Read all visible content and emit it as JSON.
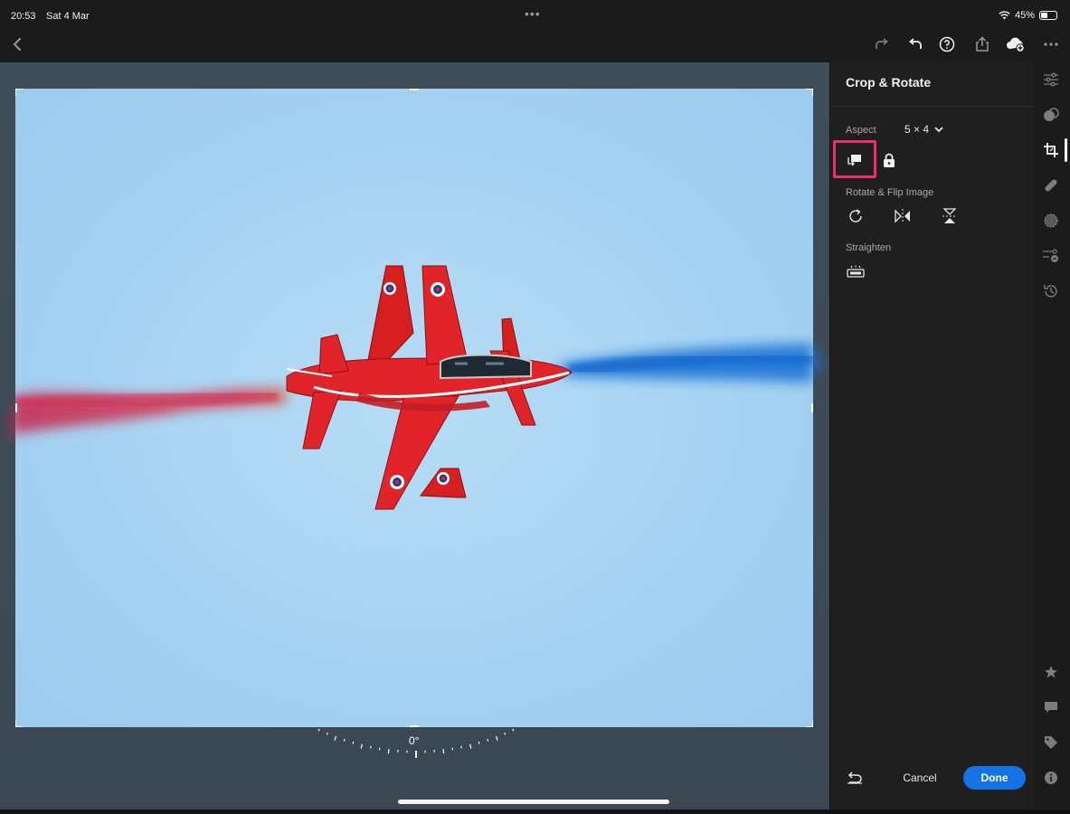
{
  "status_bar": {
    "time": "20:53",
    "date": "Sat 4 Mar",
    "battery_percent": "45%",
    "battery_level": 0.45,
    "multitask_dots": "•••"
  },
  "toolbar": {
    "icons": [
      "back-chevron-icon",
      "redo-icon",
      "undo-icon",
      "help-icon",
      "share-icon",
      "cloud-add-icon",
      "more-icon"
    ]
  },
  "canvas": {
    "straighten_angle": "0°"
  },
  "panel": {
    "title": "Crop & Rotate",
    "aspect_label": "Aspect",
    "aspect_value": "5 × 4",
    "rotate_flip_label": "Rotate & Flip Image",
    "straighten_label": "Straighten",
    "cancel_label": "Cancel",
    "done_label": "Done",
    "highlight_color": "#ef2f6a",
    "accent_color": "#1473e6"
  },
  "rail": {
    "icons": [
      "edit-sliders-icon",
      "presets-icon",
      "crop-icon",
      "healing-icon",
      "masking-icon",
      "versions-icon",
      "history-icon",
      "star-icon",
      "comment-icon",
      "tag-icon",
      "info-icon"
    ],
    "active": "crop-icon"
  }
}
